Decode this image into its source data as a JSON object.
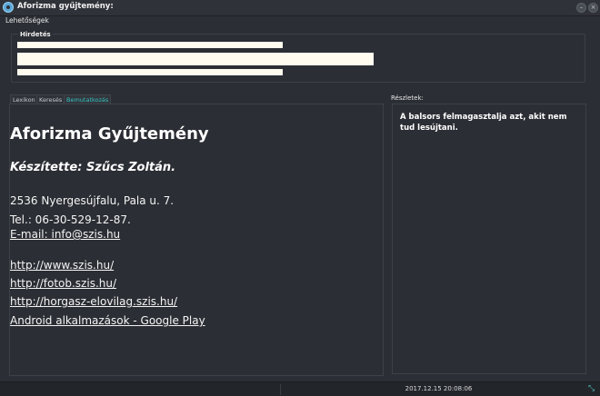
{
  "window": {
    "title": "Aforizma gyűjtemény:",
    "minimize_glyph": "–",
    "close_glyph": "×"
  },
  "menu": {
    "options_label": "Lehetőségek"
  },
  "ad": {
    "title": "Hirdetés"
  },
  "tabs": [
    {
      "label": "Lexikon",
      "active": false
    },
    {
      "label": "Keresés",
      "active": false
    },
    {
      "label": "Bemutatkozás",
      "active": true
    }
  ],
  "about": {
    "title": "Aforizma Gyűjtemény",
    "author": "Készítette: Szűcs Zoltán.",
    "address": "2536 Nyergesújfalu, Pala u. 7.",
    "phone": "Tel.: 06-30-529-12-87.",
    "email": "E-mail: info@szis.hu",
    "links": [
      "http://www.szis.hu/",
      "http://fotob.szis.hu/",
      "http://horgasz-elovilag.szis.hu/",
      "Android alkalmazások - Google Play "
    ]
  },
  "details": {
    "label": "Részletek:",
    "text": "A balsors felmagasztalja azt, akit nem tud lesújtani."
  },
  "status": {
    "datetime": "2017.12.15 20:08:06"
  },
  "colors": {
    "accent": "#32c0c0",
    "background": "#2b2e34",
    "ad_bar": "#fffbee"
  }
}
